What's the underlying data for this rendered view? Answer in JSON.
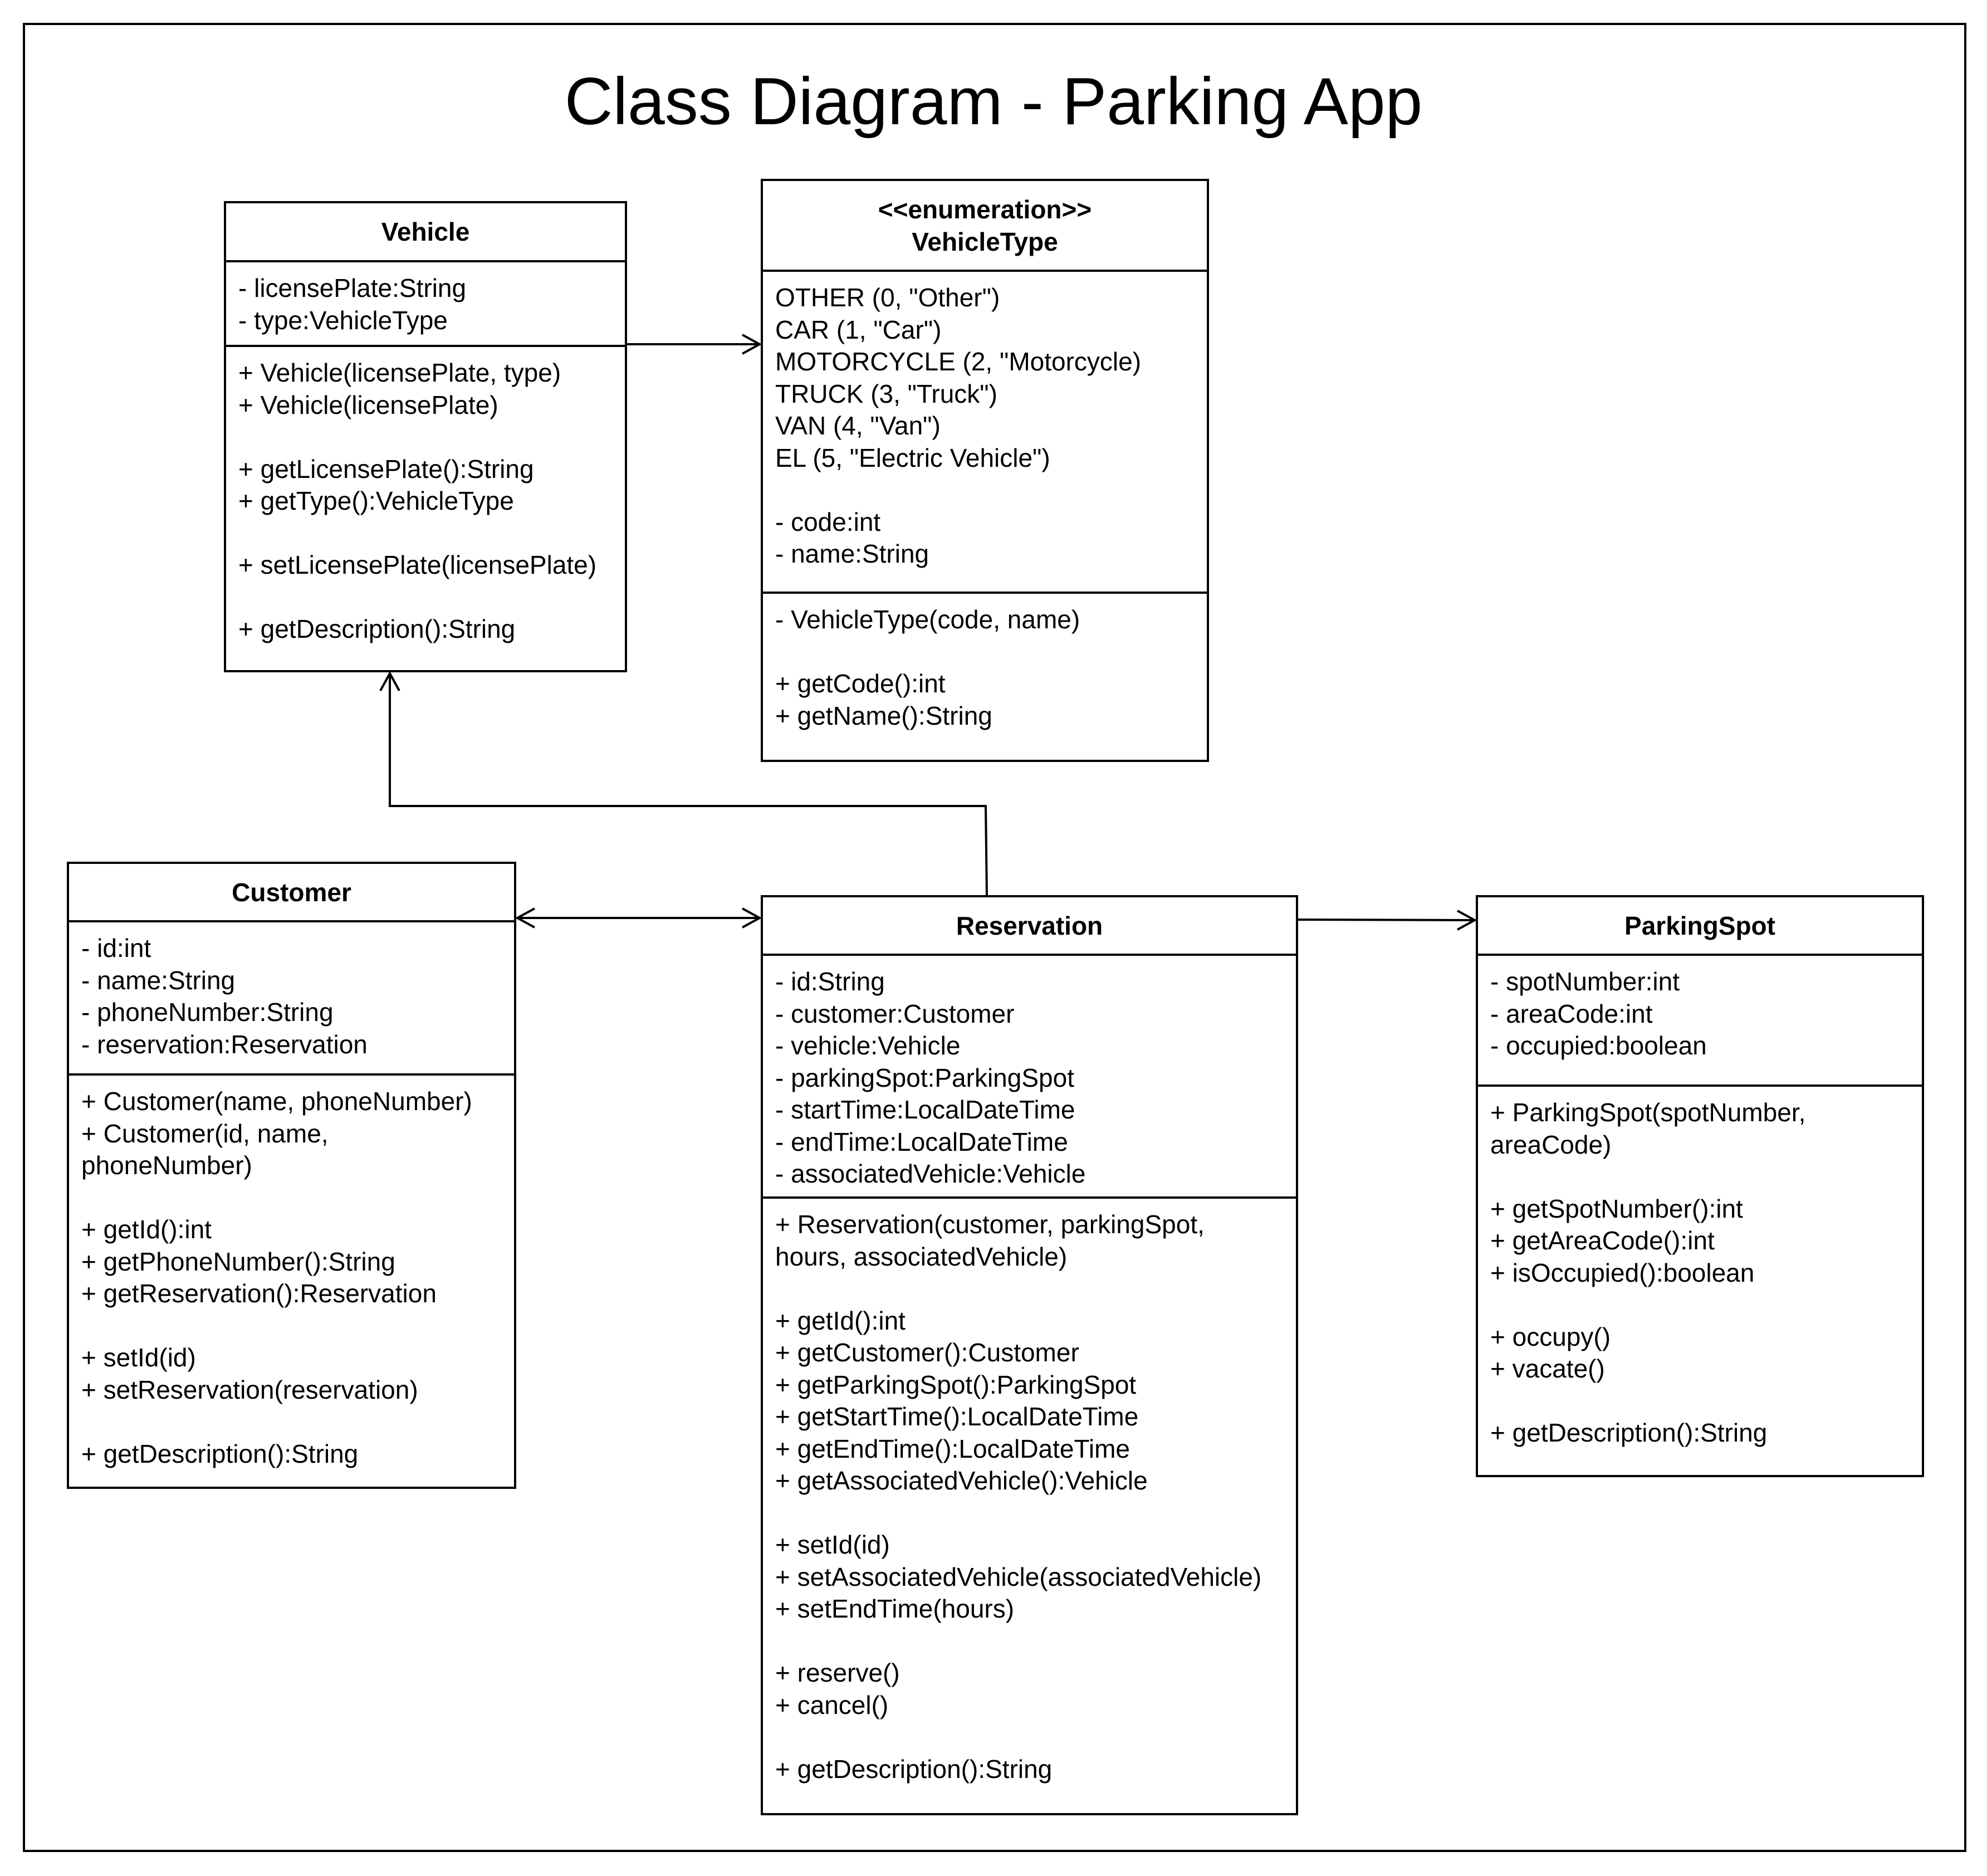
{
  "title": "Class Diagram - Parking App",
  "classes": {
    "vehicle": {
      "name": "Vehicle",
      "attributes": [
        "- licensePlate:String",
        "- type:VehicleType"
      ],
      "methods": [
        "+ Vehicle(licensePlate, type)",
        "+ Vehicle(licensePlate)",
        "",
        "+ getLicensePlate():String",
        "+ getType():VehicleType",
        "",
        "+ setLicensePlate(licensePlate)",
        "",
        "+ getDescription():String"
      ]
    },
    "vehicle_type": {
      "stereotype": "<<enumeration>>",
      "name": "VehicleType",
      "attributes": [
        "OTHER (0, \"Other\")",
        "CAR (1, \"Car\")",
        "MOTORCYCLE (2, \"Motorcycle)",
        "TRUCK (3, \"Truck\")",
        "VAN (4, \"Van\")",
        "EL (5, \"Electric Vehicle\")",
        "",
        "- code:int",
        "- name:String"
      ],
      "methods": [
        "- VehicleType(code, name)",
        "",
        "+ getCode():int",
        "+ getName():String"
      ]
    },
    "customer": {
      "name": "Customer",
      "attributes": [
        "- id:int",
        "- name:String",
        "- phoneNumber:String",
        "- reservation:Reservation"
      ],
      "methods": [
        "+ Customer(name, phoneNumber)",
        "+ Customer(id, name,",
        "phoneNumber)",
        "",
        "+ getId():int",
        "+ getPhoneNumber():String",
        "+ getReservation():Reservation",
        "",
        "+ setId(id)",
        "+ setReservation(reservation)",
        "",
        "+ getDescription():String"
      ]
    },
    "reservation": {
      "name": "Reservation",
      "attributes": [
        "- id:String",
        "- customer:Customer",
        "- vehicle:Vehicle",
        "- parkingSpot:ParkingSpot",
        "- startTime:LocalDateTime",
        "- endTime:LocalDateTime",
        "- associatedVehicle:Vehicle"
      ],
      "methods": [
        "+ Reservation(customer, parkingSpot,",
        "hours, associatedVehicle)",
        "",
        "+ getId():int",
        "+ getCustomer():Customer",
        "+ getParkingSpot():ParkingSpot",
        "+ getStartTime():LocalDateTime",
        "+ getEndTime():LocalDateTime",
        "+ getAssociatedVehicle():Vehicle",
        "",
        "+ setId(id)",
        "+ setAssociatedVehicle(associatedVehicle)",
        "+ setEndTime(hours)",
        "",
        "+ reserve()",
        "+ cancel()",
        "",
        "+ getDescription():String"
      ]
    },
    "parking_spot": {
      "name": "ParkingSpot",
      "attributes": [
        "- spotNumber:int",
        "- areaCode:int",
        "- occupied:boolean"
      ],
      "methods": [
        "+ ParkingSpot(spotNumber,",
        "areaCode)",
        "",
        "+ getSpotNumber():int",
        "+ getAreaCode():int",
        "+ isOccupied():boolean",
        "",
        "+ occupy()",
        "+ vacate()",
        "",
        "+ getDescription():String"
      ]
    }
  }
}
